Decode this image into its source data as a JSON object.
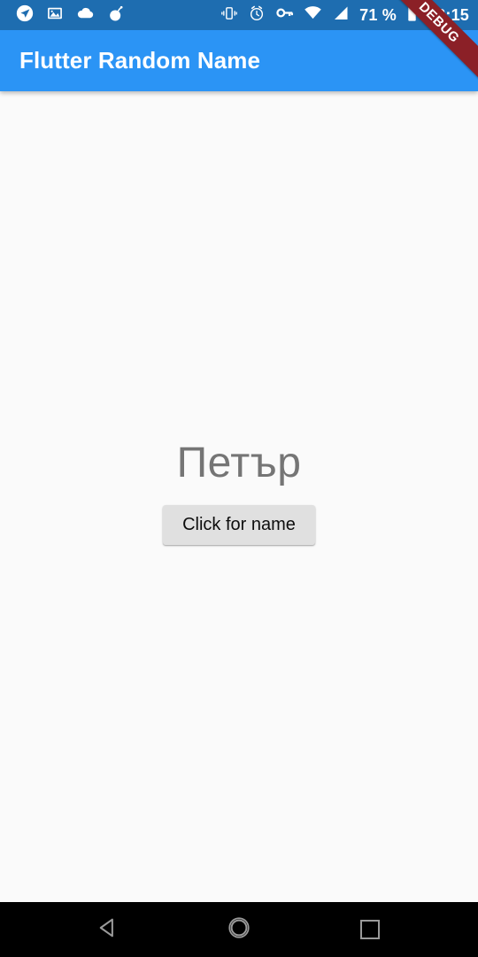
{
  "status_bar": {
    "background_color": "#1E6DB0",
    "left_icons": [
      {
        "name": "location-icon",
        "label": "location"
      },
      {
        "name": "photo-icon",
        "label": "screenshot"
      },
      {
        "name": "cloud-icon",
        "label": "cloud sync"
      },
      {
        "name": "bomb-icon",
        "label": "bomb"
      }
    ],
    "right_icons": [
      {
        "name": "vibrate-icon",
        "label": "vibrate"
      },
      {
        "name": "alarm-icon",
        "label": "alarm"
      },
      {
        "name": "vpn-key-icon",
        "label": "vpn"
      },
      {
        "name": "wifi-icon",
        "label": "wifi"
      },
      {
        "name": "cellular-signal-icon",
        "label": "signal"
      }
    ],
    "battery_percent": "71 %",
    "battery_icon": "battery-icon",
    "clock": "23:15"
  },
  "app_bar": {
    "title": "Flutter Random Name",
    "background_color": "#2B94F5",
    "text_color": "#FFFFFF"
  },
  "debug_banner": {
    "label": "DEBUG",
    "background_color": "#8B2027",
    "text_color": "#FFFFFF"
  },
  "content": {
    "background_color": "#FAFAFA",
    "name": "Петър",
    "name_color": "#757575",
    "button_label": "Click for name",
    "button_color": "#E0E0E0",
    "button_text_color": "#0D0D0D"
  },
  "nav_bar": {
    "background_color": "#000000",
    "buttons": [
      {
        "name": "nav-back-button",
        "icon": "back-triangle-icon"
      },
      {
        "name": "nav-home-button",
        "icon": "home-circle-icon"
      },
      {
        "name": "nav-recents-button",
        "icon": "recents-square-icon"
      }
    ]
  }
}
